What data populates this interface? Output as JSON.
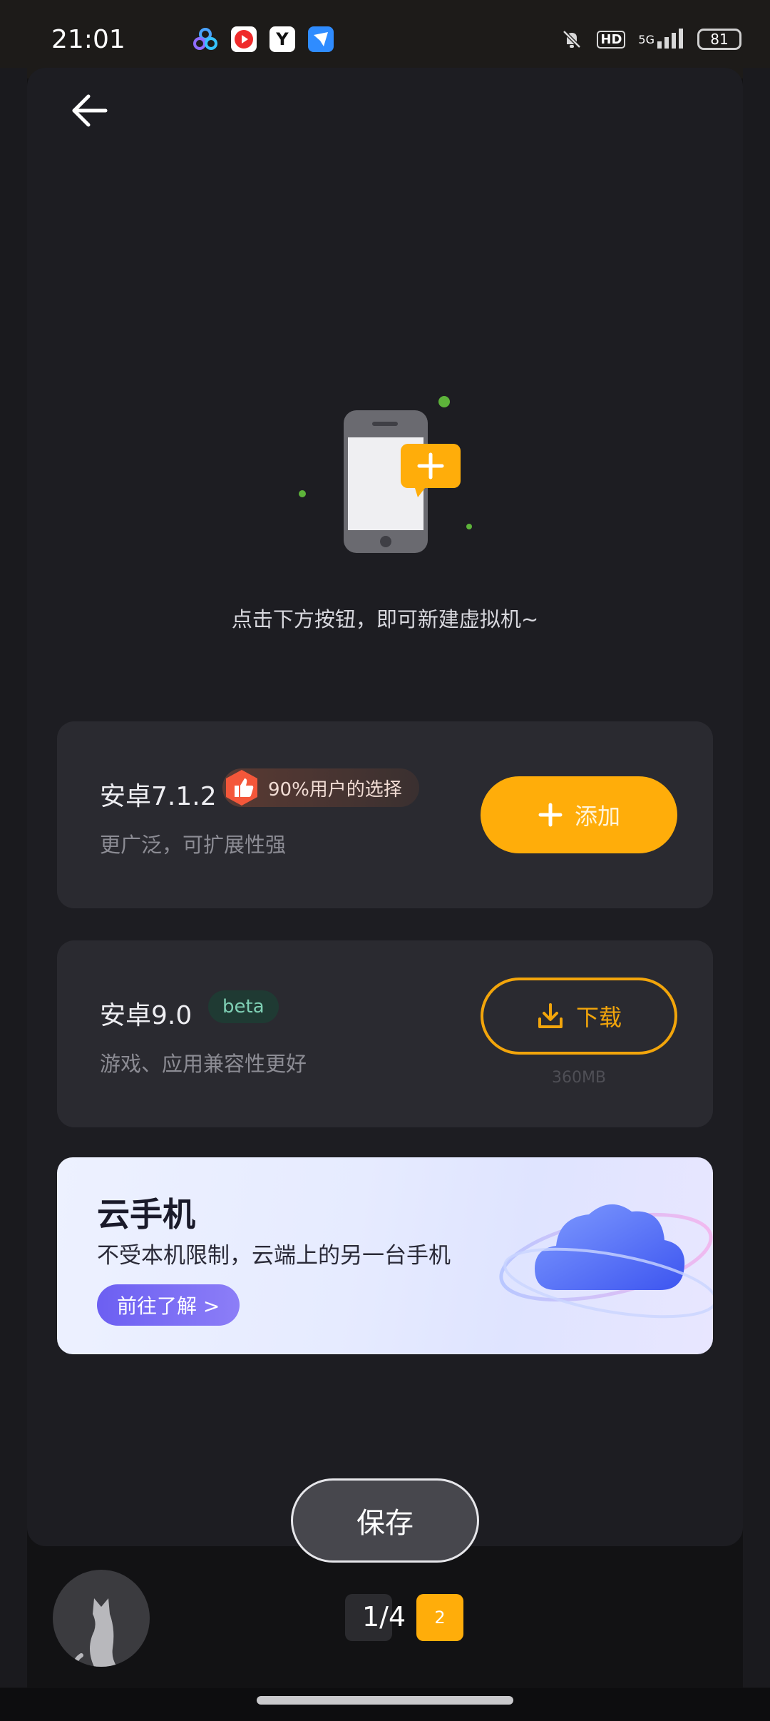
{
  "status_bar": {
    "time": "21:01",
    "app_icons": [
      "cluster-app-icon",
      "video-app-icon",
      "y-app-icon",
      "mail-app-icon"
    ],
    "icons": [
      "mute-icon",
      "hd-icon",
      "5g-signal-icon"
    ],
    "hd_label": "HD",
    "network_label": "5G",
    "battery": "81"
  },
  "navigation": {
    "back_icon": "arrow-left-icon"
  },
  "empty_state": {
    "hint": "点击下方按钮，即可新建虚拟机~"
  },
  "options": [
    {
      "title": "安卓7.1.2",
      "badge": "90%用户的选择",
      "description": "更广泛，可扩展性强",
      "button_label": "添加",
      "button_icon": "plus-icon"
    },
    {
      "title": "安卓9.0",
      "badge": "beta",
      "description": "游戏、应用兼容性更好",
      "button_label": "下载",
      "button_icon": "download-icon",
      "size": "360MB"
    }
  ],
  "cloud_banner": {
    "title": "云手机",
    "subtitle": "不受本机限制，云端上的另一台手机",
    "button_label": "前往了解 >"
  },
  "save_label": "保存",
  "pager": {
    "text": "1/4",
    "page_two": "2"
  },
  "colors": {
    "accent": "#ffad0a",
    "panel": "#1d1d22",
    "card": "#2a2a30",
    "banner_button": "#6c5ff2"
  }
}
